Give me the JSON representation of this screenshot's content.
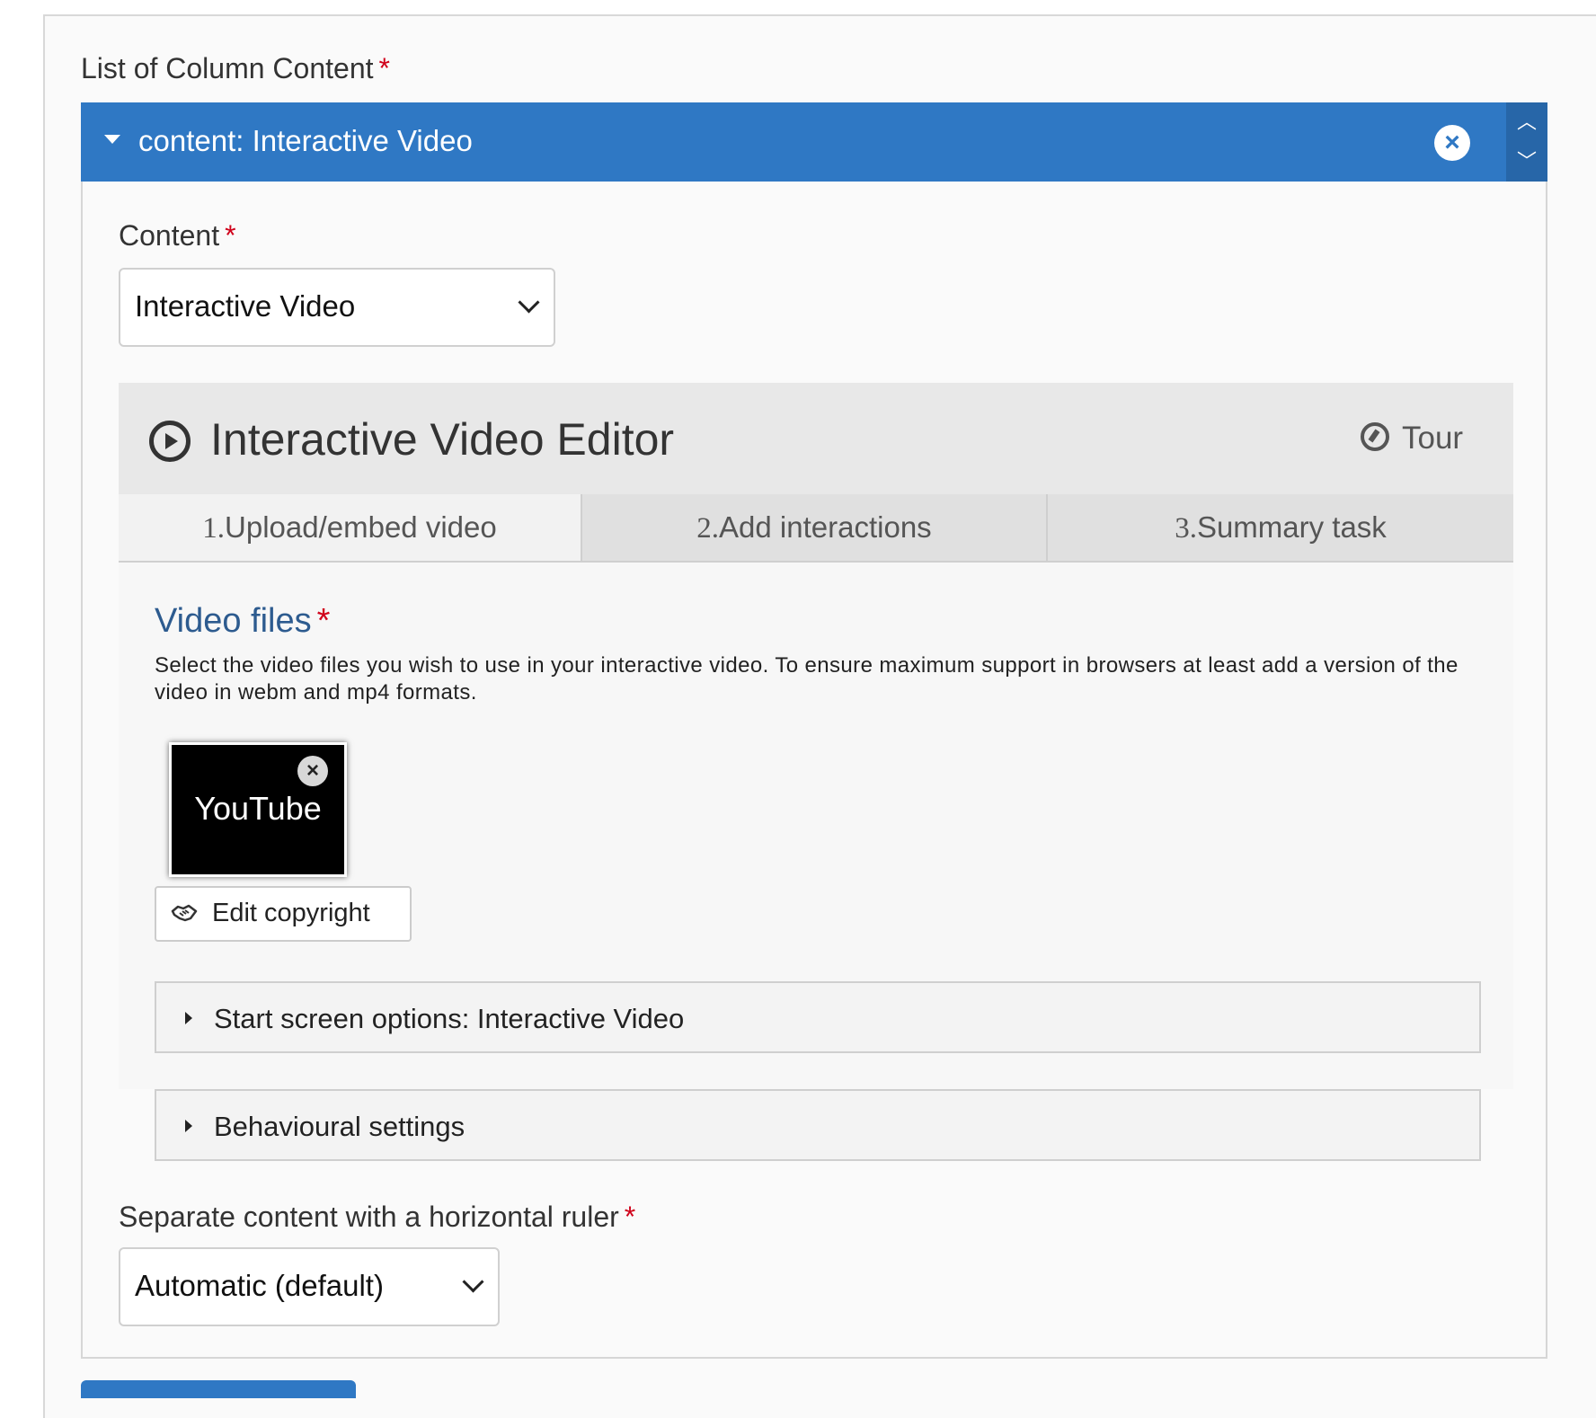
{
  "list": {
    "label": "List of Column Content",
    "required_mark": "*"
  },
  "group": {
    "title": "content: Interactive Video",
    "remove_icon": "×",
    "move_up_icon": "︿",
    "move_down_icon": "﹀",
    "accent_color": "#2f78c4"
  },
  "content_field": {
    "label": "Content",
    "required_mark": "*",
    "selected": "Interactive Video"
  },
  "editor": {
    "title": "Interactive Video Editor",
    "tour_label": "Tour",
    "tabs": [
      {
        "num": "1.",
        "label": "Upload/embed video"
      },
      {
        "num": "2.",
        "label": "Add interactions"
      },
      {
        "num": "3.",
        "label": "Summary task"
      }
    ],
    "video_files": {
      "title": "Video files",
      "required_mark": "*",
      "description": "Select the video files you wish to use in your interactive video. To ensure maximum support in browsers at least add a version of the video in webm and mp4 formats.",
      "thumbnail_label": "YouTube",
      "thumbnail_remove_icon": "×"
    },
    "edit_copyright_label": "Edit copyright"
  },
  "sections": {
    "start_screen": "Start screen options: Interactive Video",
    "behavioural": "Behavioural settings"
  },
  "separator_field": {
    "label": "Separate content with a horizontal ruler",
    "required_mark": "*",
    "selected": "Automatic (default)"
  }
}
